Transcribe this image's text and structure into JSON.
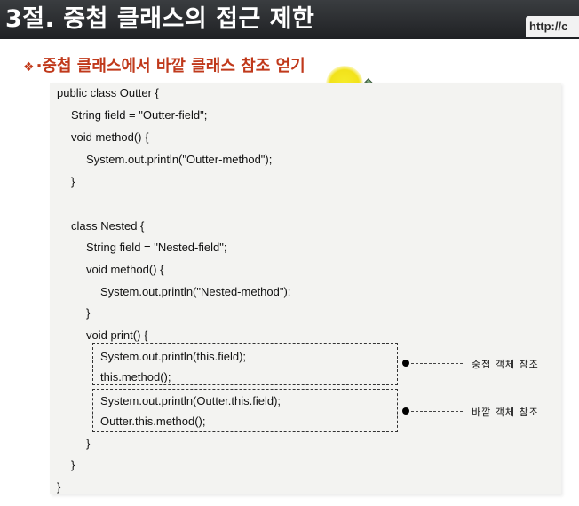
{
  "header": {
    "title": "3절. 중첩 클래스의 접근 제한",
    "url_fragment": "http://c"
  },
  "subtitle": {
    "bullet": "❖",
    "text": "·중첩 클래스에서 바깥 클래스 참조 얻기"
  },
  "code": {
    "lines": [
      "public class Outter {",
      "String field = \"Outter-field\";",
      "void method() {",
      "System.out.println(\"Outter-method\");",
      "}",
      "class Nested {",
      "String field = \"Nested-field\";",
      "void method() {",
      "System.out.println(\"Nested-method\");",
      "}",
      "void print() {",
      "System.out.println(this.field);",
      "this.method();",
      "System.out.println(Outter.this.field);",
      "Outter.this.method();",
      "}",
      "}",
      "}"
    ]
  },
  "annotations": {
    "nested_ref": "중첩 객체 참조",
    "outer_ref": "바깥 객체 참조"
  },
  "icons": {
    "pointer": "pen-icon",
    "bullet": "diamond-bullet-icon"
  },
  "colors": {
    "header_bg": "#2a2c2f",
    "subtitle": "#c0391b",
    "highlight": "#f2e21a",
    "code_panel": "#f3f3f1"
  }
}
